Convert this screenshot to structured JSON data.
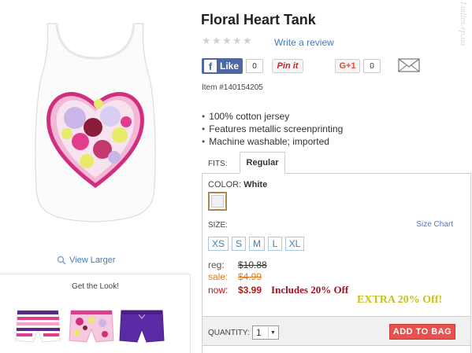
{
  "product": {
    "title": "Floral Heart Tank",
    "write_review": "Write a review",
    "item_number": "Item #140154205",
    "features": [
      "100% cotton jersey",
      "Features metallic screenprinting",
      "Machine washable; imported"
    ]
  },
  "social": {
    "like_label": "Like",
    "like_count": "0",
    "pinit_label": "Pin it",
    "gplus_label": "G+1",
    "gplus_count": "0"
  },
  "image": {
    "view_larger": "View Larger"
  },
  "get_the_look": {
    "title": "Get the Look!"
  },
  "fits": {
    "label": "FITS:",
    "selected_tab": "Regular"
  },
  "color": {
    "label": "COLOR:",
    "selected": "White"
  },
  "size": {
    "label": "SIZE:",
    "chart_link": "Size Chart",
    "options": [
      "XS",
      "S",
      "M",
      "L",
      "XL"
    ]
  },
  "pricing": {
    "reg_label": "reg:",
    "reg_price": "$10.88",
    "sale_label": "sale:",
    "sale_price": "$4.99",
    "now_label": "now:",
    "now_price": "$3.99",
    "promo_text": "Includes 20% Off",
    "extra_promo": "EXTRA 20% Off!"
  },
  "purchase": {
    "quantity_label": "QUANTITY:",
    "quantity_value": "1",
    "add_to_bag": "ADD TO BAG"
  },
  "watermark": "Ladies.ep.ua",
  "colors": {
    "link": "#4a7ab5",
    "facebook": "#4e69a2",
    "add_to_bag": "#e8514e",
    "sale": "#e07a1c",
    "now": "#c0141c",
    "extra": "#c7c11c"
  }
}
